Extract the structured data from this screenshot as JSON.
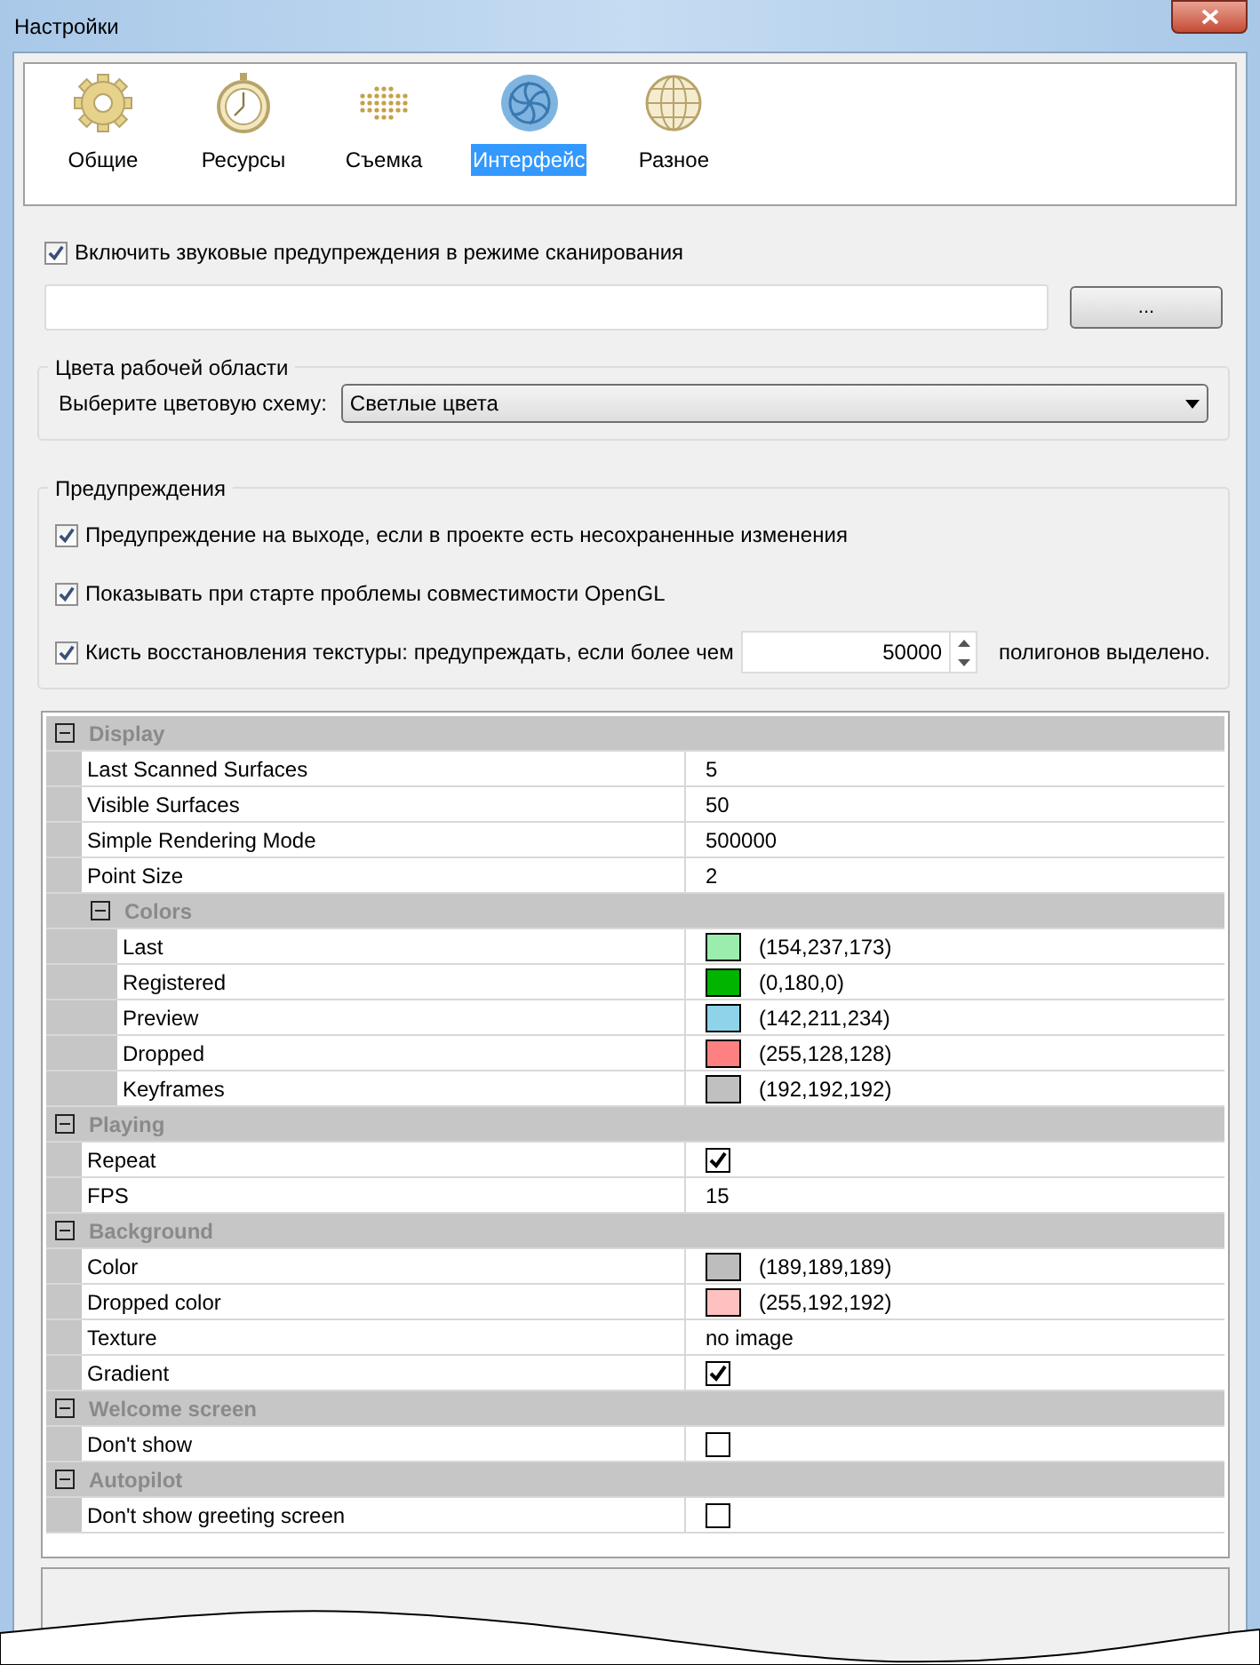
{
  "window": {
    "title": "Настройки"
  },
  "tabs": [
    {
      "label": "Общие",
      "selected": false
    },
    {
      "label": "Ресурсы",
      "selected": false
    },
    {
      "label": "Съемка",
      "selected": false
    },
    {
      "label": "Интерфейс",
      "selected": true
    },
    {
      "label": "Разное",
      "selected": false
    }
  ],
  "sound_warning": {
    "label": "Включить звуковые предупреждения в режиме сканирования",
    "checked": true
  },
  "browse_button": {
    "label": "..."
  },
  "workspace_colors": {
    "title": "Цвета рабочей области",
    "label": "Выберите цветовую схему:",
    "value": "Светлые цвета"
  },
  "warnings": {
    "title": "Предупреждения",
    "items": [
      {
        "kind": "checkbox",
        "label": "Предупреждение на выходе, если в проекте есть несохраненные изменения",
        "checked": true
      },
      {
        "kind": "checkbox",
        "label": "Показывать при старте проблемы совместимости OpenGL",
        "checked": true
      },
      {
        "kind": "spin",
        "label": "Кисть восстановления текстуры: предупреждать, если более чем",
        "checked": true,
        "value": "50000",
        "suffix": "полигонов выделено."
      }
    ]
  },
  "properties": [
    {
      "label": "Display",
      "expanded": true,
      "children": [
        {
          "kind": "text",
          "name": "Last Scanned Surfaces",
          "value": "5"
        },
        {
          "kind": "text",
          "name": "Visible Surfaces",
          "value": "50"
        },
        {
          "kind": "text",
          "name": "Simple Rendering Mode",
          "value": "500000"
        },
        {
          "kind": "text",
          "name": "Point Size",
          "value": "2"
        },
        {
          "kind": "group",
          "label": "Colors",
          "expanded": true,
          "children": [
            {
              "kind": "color",
              "name": "Last",
              "color": "#9aedad",
              "value": "(154,237,173)"
            },
            {
              "kind": "color",
              "name": "Registered",
              "color": "#00b400",
              "value": "(0,180,0)"
            },
            {
              "kind": "color",
              "name": "Preview",
              "color": "#8ed3ea",
              "value": "(142,211,234)"
            },
            {
              "kind": "color",
              "name": "Dropped",
              "color": "#ff8080",
              "value": "(255,128,128)"
            },
            {
              "kind": "color",
              "name": "Keyframes",
              "color": "#c0c0c0",
              "value": "(192,192,192)"
            }
          ]
        }
      ]
    },
    {
      "label": "Playing",
      "expanded": true,
      "children": [
        {
          "kind": "checkbox",
          "name": "Repeat",
          "checked": true
        },
        {
          "kind": "text",
          "name": "FPS",
          "value": "15"
        }
      ]
    },
    {
      "label": "Background",
      "expanded": true,
      "children": [
        {
          "kind": "color",
          "name": "Color",
          "color": "#bdbdbd",
          "value": "(189,189,189)"
        },
        {
          "kind": "color",
          "name": "Dropped color",
          "color": "#ffc0c0",
          "value": "(255,192,192)"
        },
        {
          "kind": "text",
          "name": "Texture",
          "value": "no image"
        },
        {
          "kind": "checkbox",
          "name": "Gradient",
          "checked": true
        }
      ]
    },
    {
      "label": "Welcome screen",
      "expanded": true,
      "children": [
        {
          "kind": "checkbox",
          "name": "Don't show",
          "checked": false
        }
      ]
    },
    {
      "label": "Autopilot",
      "expanded": true,
      "children": [
        {
          "kind": "checkbox",
          "name": "Don't show greeting screen",
          "checked": false
        }
      ]
    }
  ]
}
